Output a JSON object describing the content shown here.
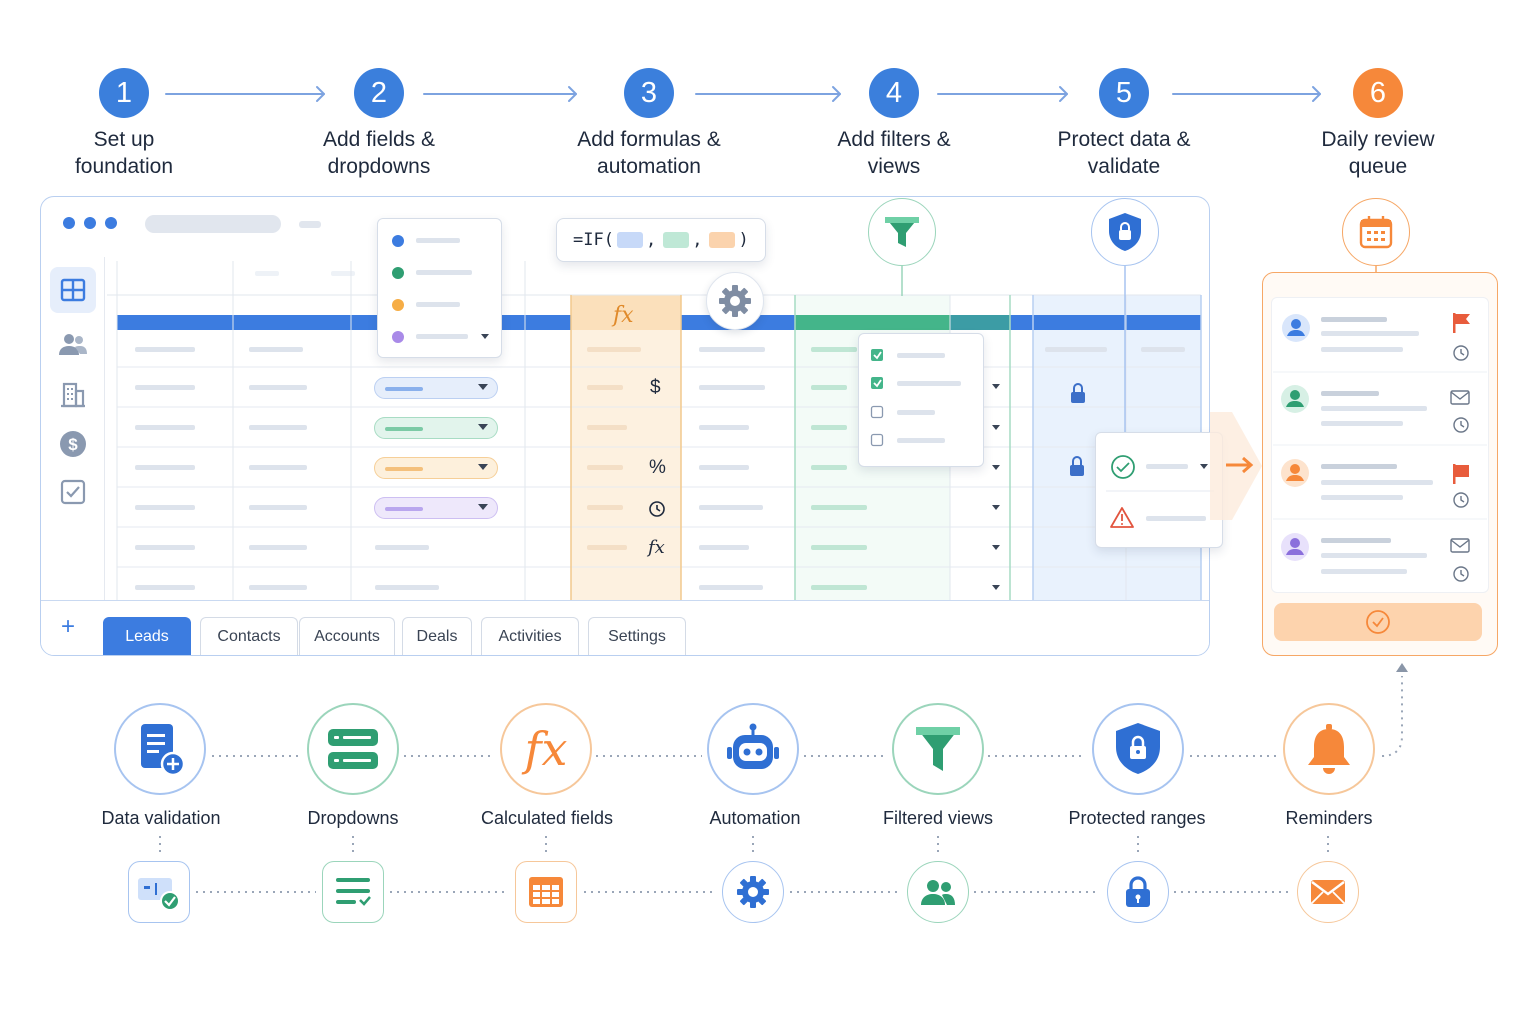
{
  "steps": [
    {
      "number": "1",
      "label": "Set up\nfoundation",
      "color": "#3b7fdc"
    },
    {
      "number": "2",
      "label": "Add fields &\ndropdowns",
      "color": "#3b7fdc"
    },
    {
      "number": "3",
      "label": "Add formulas &\nautomation",
      "color": "#3b7fdc"
    },
    {
      "number": "4",
      "label": "Add filters &\nviews",
      "color": "#3b7fdc"
    },
    {
      "number": "5",
      "label": "Protect data &\nvalidate",
      "color": "#3b7fdc"
    },
    {
      "number": "6",
      "label": "Daily review\nqueue",
      "color": "#f6883a"
    }
  ],
  "formula": {
    "prefix": "=IF(",
    "sep1": ",",
    "sep2": ",",
    "suffix": ")"
  },
  "formula_column": {
    "header_symbol": "fx",
    "row_symbols": [
      "$",
      "%",
      "clock-icon",
      "fx"
    ]
  },
  "tabs": {
    "add_label": "+",
    "items": [
      "Leads",
      "Contacts",
      "Accounts",
      "Deals",
      "Activities",
      "Settings"
    ],
    "active": "Leads"
  },
  "features": [
    {
      "label": "Data validation",
      "icon": "document-add-icon",
      "sub_icon": "checked-field-icon",
      "color": "#3b7fdc"
    },
    {
      "label": "Dropdowns",
      "icon": "list-rows-icon",
      "sub_icon": "list-check-icon",
      "color": "#2f9e72"
    },
    {
      "label": "Calculated fields",
      "icon": "fx-icon",
      "sub_icon": "grid-table-icon",
      "color": "#f6883a"
    },
    {
      "label": "Automation",
      "icon": "robot-icon",
      "sub_icon": "gear-icon",
      "color": "#3b7fdc"
    },
    {
      "label": "Filtered views",
      "icon": "funnel-icon",
      "sub_icon": "users-icon",
      "color": "#2f9e72"
    },
    {
      "label": "Protected ranges",
      "icon": "shield-lock-icon",
      "sub_icon": "lock-icon",
      "color": "#3b7fdc"
    },
    {
      "label": "Reminders",
      "icon": "bell-icon",
      "sub_icon": "mail-icon",
      "color": "#f6883a"
    }
  ],
  "colors": {
    "blue": "#3b7fdc",
    "green": "#2f9e72",
    "orange": "#f6883a",
    "purple": "#9b7fe0"
  }
}
